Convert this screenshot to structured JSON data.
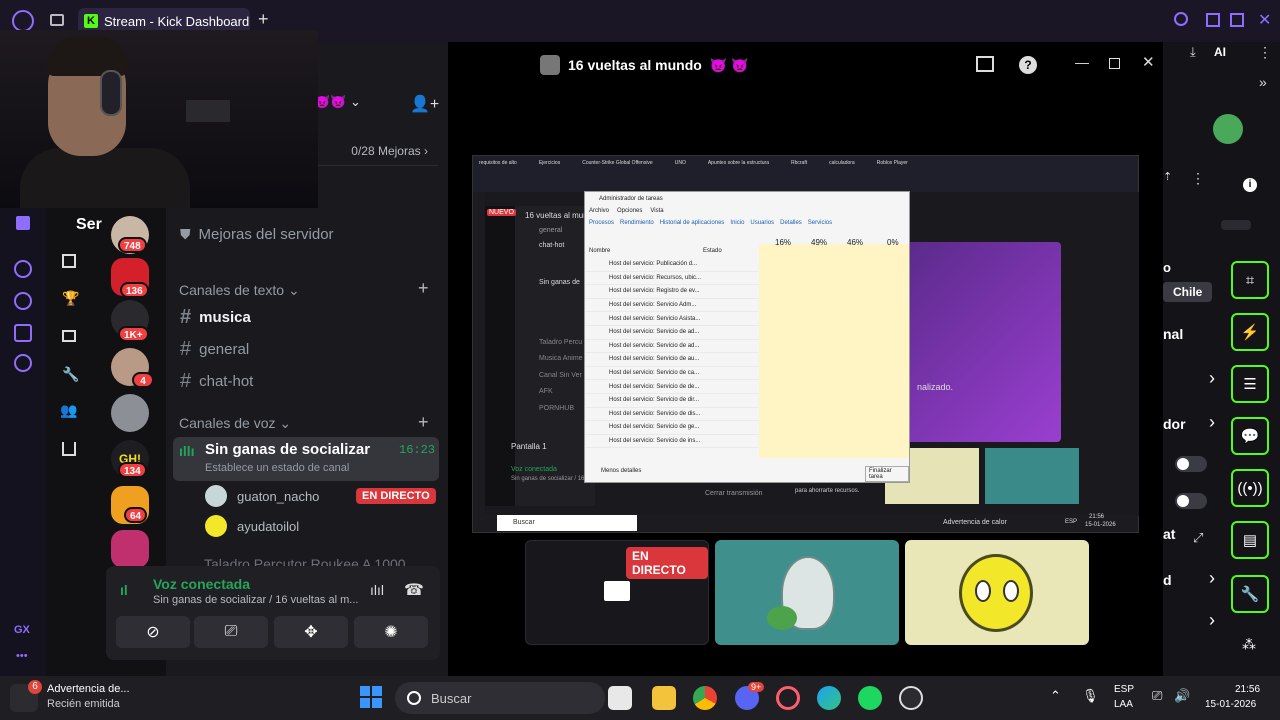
{
  "browser": {
    "tab_title": "Stream - Kick Dashboard",
    "new_tab_symbol": "+"
  },
  "window": {
    "title": "16 vueltas al mundo",
    "title_emoji": "👿 👿"
  },
  "discord": {
    "server_truncated": "Ser",
    "boosts_label": "0/28 Mejoras",
    "server_boost_link": "Mejoras del servidor",
    "text_channels_header": "Canales de texto",
    "text_channels": [
      "musica",
      "general",
      "chat-hot"
    ],
    "voice_channels_header": "Canales de voz",
    "active_voice_channel": {
      "name": "Sin ganas de socializar",
      "timer": "16:23",
      "status_hint": "Establece un estado de canal"
    },
    "voice_users": [
      {
        "name": "guaton_nacho",
        "badge": "EN DIRECTO"
      },
      {
        "name": "ayudatoilol",
        "badge": ""
      }
    ],
    "next_channel_partial": "Taladro Percutor Roukee A 1000",
    "server_badges": [
      "748",
      "136",
      "1K+",
      "4",
      "134",
      "64"
    ],
    "voice_panel": {
      "title": "Voz conectada",
      "subtitle": "Sin ganas de socializar / 16 vueltas al m..."
    }
  },
  "stage": {
    "live_badge": "EN DIRECTO"
  },
  "screenshare": {
    "desktop_icons": [
      "requisitos de alto",
      "Ejercicios",
      "Counter-Strike Global Offensive",
      "UNO",
      "Apuntes sobre la estructura",
      "Rbcraft",
      "calculadora",
      "Roblox Player"
    ],
    "taskmgr": {
      "title": "Administrador de tareas",
      "menu": [
        "Archivo",
        "Opciones",
        "Vista"
      ],
      "tabs": [
        "Procesos",
        "Rendimiento",
        "Historial de aplicaciones",
        "Inicio",
        "Usuarios",
        "Detalles",
        "Servicios"
      ],
      "cpu": "16%",
      "memoria": "49%",
      "disco": "46%",
      "red": "0%",
      "col_nombre": "Nombre",
      "col_estado": "Estado",
      "rows": [
        "Host del servicio: Publicación d...",
        "Host del servicio: Recursos, ubic...",
        "Host del servicio: Registro de ev...",
        "Host del servicio: Servicio Adm...",
        "Host del servicio: Servicio Asista...",
        "Host del servicio: Servicio de ad...",
        "Host del servicio: Servicio de ad...",
        "Host del servicio: Servicio de au...",
        "Host del servicio: Servicio de ca...",
        "Host del servicio: Servicio de de...",
        "Host del servicio: Servicio de dir...",
        "Host del servicio: Servicio de dis...",
        "Host del servicio: Servicio de ge...",
        "Host del servicio: Servicio de ins..."
      ],
      "less_details": "Menos detalles",
      "end_task": "Finalizar tarea"
    },
    "inner_discord": {
      "new_label": "NUEVO",
      "window_title": "16 vueltas al mund",
      "channels": [
        "general",
        "chat-hot",
        "Sin ganas de",
        "Taladro Percu",
        "Musica Anime",
        "Canal Sin Ver",
        "AFK",
        "PORNHUB"
      ],
      "screen_label": "Pantalla 1",
      "voice_status": "Voz conectada",
      "voice_sub": "Sin ganas de socializar / 16"
    },
    "notice": "Cerrar transmisión",
    "hint": "para ahorrarte recursos.",
    "finalized": "nalizado.",
    "taskbar_search": "Buscar",
    "heat_warning": "Advertencia de calor",
    "tray_lang": "ESP",
    "tray_time": "21:56",
    "tray_date": "15-01-2026"
  },
  "kick_right": {
    "chip_chile": "Chile",
    "label_nal": "nal",
    "label_dor": "dor",
    "label_at": "at",
    "label_d": "d",
    "label_o": "o",
    "ai_label": "AI"
  },
  "taskbar": {
    "notification_title": "Advertencia de...",
    "notification_sub": "Recién emitida",
    "notification_count": "6",
    "search_placeholder": "Buscar",
    "discord_badge": "9+",
    "lang_line1": "ESP",
    "lang_line2": "LAA",
    "time": "21:56",
    "date": "15-01-2026"
  },
  "gx_label": "GX",
  "colors": {
    "kick_green": "#53fc18",
    "discord_red": "#da373c",
    "voice_green": "#23a55a",
    "gx_purple": "#8f6dff"
  }
}
